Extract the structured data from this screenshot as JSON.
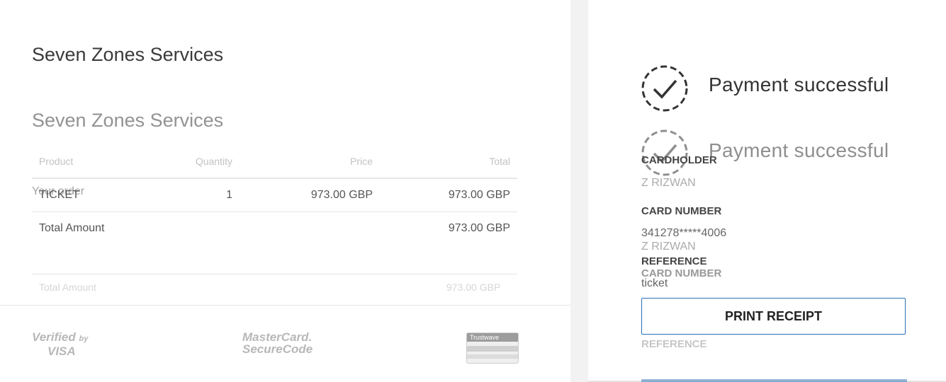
{
  "merchant": {
    "name": "Seven Zones Services"
  },
  "order": {
    "heading": "Your order",
    "columns": [
      "Product",
      "Quantity",
      "Price",
      "Total"
    ],
    "rows": [
      {
        "product": "TICKET",
        "quantity": "1",
        "price": "973.00 GBP",
        "total": "973.00 GBP"
      }
    ],
    "total_label": "Total Amount",
    "total_value": "973.00 GBP"
  },
  "badges": {
    "visa_line1": "Verified",
    "visa_by": "by",
    "visa_line2": "VISA",
    "mc_line1": "MasterCard.",
    "mc_line2": "SecureCode",
    "trustwave": "Trustwave"
  },
  "payment": {
    "status": "Payment successful",
    "cardholder_label": "CARDHOLDER",
    "cardholder_value": "Z RIZWAN",
    "card_number_label": "CARD NUMBER",
    "card_number_value": "341278*****4006",
    "reference_label": "REFERENCE",
    "reference_value": "ticket",
    "print_label": "PRINT RECEIPT"
  },
  "colors": {
    "accent": "#2a6fb5",
    "divider": "#f2f2f2"
  }
}
